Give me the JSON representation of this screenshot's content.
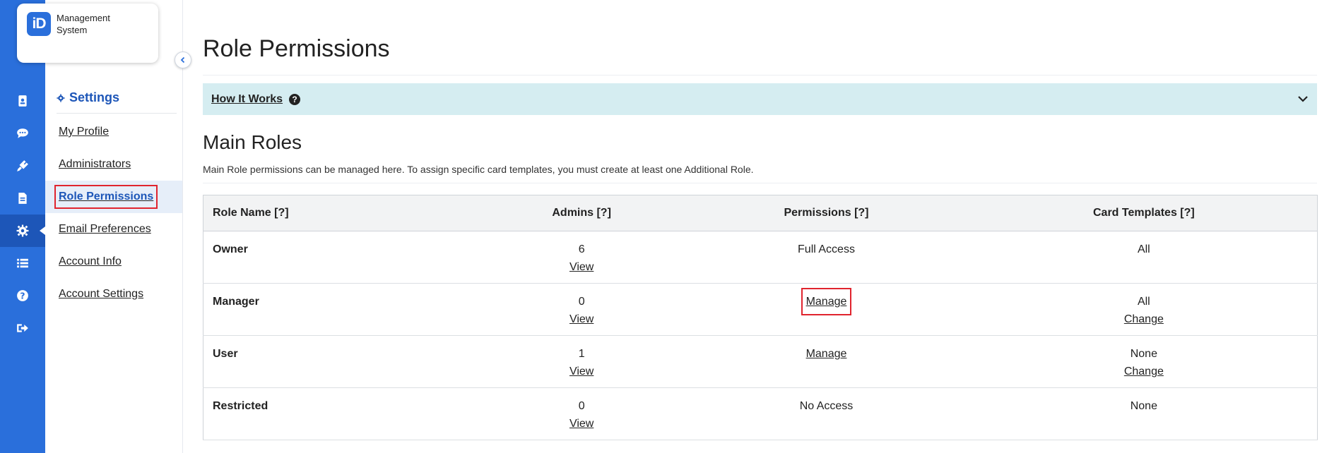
{
  "app": {
    "logo_mark": "iD",
    "logo_line1": "Management",
    "logo_line2": "System"
  },
  "rail": {
    "items": [
      {
        "icon": "contact-card-icon"
      },
      {
        "icon": "chat-icon"
      },
      {
        "icon": "plug-icon"
      },
      {
        "icon": "document-icon"
      },
      {
        "icon": "gear-icon",
        "active": true
      },
      {
        "icon": "list-icon"
      },
      {
        "icon": "help-icon"
      },
      {
        "icon": "sign-out-icon"
      }
    ]
  },
  "sidebar": {
    "heading": "Settings",
    "items": [
      {
        "label": "My Profile"
      },
      {
        "label": "Administrators"
      },
      {
        "label": "Role Permissions",
        "active": true
      },
      {
        "label": "Email Preferences"
      },
      {
        "label": "Account Info"
      },
      {
        "label": "Account Settings"
      }
    ]
  },
  "main": {
    "title": "Role Permissions",
    "how_it_works": "How It Works",
    "section_title": "Main Roles",
    "section_desc": "Main Role permissions can be managed here. To assign specific card templates, you must create at least one Additional Role.",
    "table": {
      "headers": [
        "Role Name [?]",
        "Admins [?]",
        "Permissions [?]",
        "Card Templates [?]"
      ],
      "rows": [
        {
          "role": "Owner",
          "admins": "6",
          "admins_link": "View",
          "permissions": "Full Access",
          "permissions_link": "",
          "templates": "All",
          "templates_link": ""
        },
        {
          "role": "Manager",
          "admins": "0",
          "admins_link": "View",
          "permissions": "",
          "permissions_link": "Manage",
          "templates": "All",
          "templates_link": "Change"
        },
        {
          "role": "User",
          "admins": "1",
          "admins_link": "View",
          "permissions": "",
          "permissions_link": "Manage",
          "templates": "None",
          "templates_link": "Change"
        },
        {
          "role": "Restricted",
          "admins": "0",
          "admins_link": "View",
          "permissions": "No Access",
          "permissions_link": "",
          "templates": "None",
          "templates_link": ""
        }
      ]
    }
  },
  "colors": {
    "brand": "#2a6fdb",
    "highlight": "#e0242e",
    "info_bar": "#d5edf1"
  }
}
